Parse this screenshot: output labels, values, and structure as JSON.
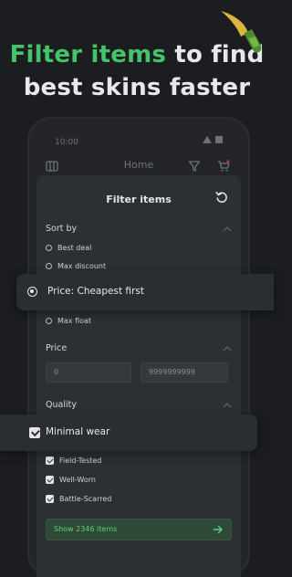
{
  "headline": {
    "line1_green": "Filter items",
    "line1_rest": " to find",
    "line2": "best skins faster"
  },
  "phone": {
    "status_time": "10:00",
    "appbar_title": "Home"
  },
  "filter": {
    "title": "Filter items",
    "sort": {
      "label": "Sort by",
      "options": [
        {
          "label": "Best deal",
          "selected": false
        },
        {
          "label": "Max discount",
          "selected": false
        },
        {
          "label": "Price: Cheapest first",
          "selected": true
        },
        {
          "label": "Max float",
          "selected": false
        }
      ]
    },
    "price": {
      "label": "Price",
      "min_value": "0",
      "max_value": "9999999999"
    },
    "quality": {
      "label": "Quality",
      "options": [
        {
          "label": "Minimal wear",
          "checked": true
        },
        {
          "label": "Field-Tested",
          "checked": true
        },
        {
          "label": "Well-Worn",
          "checked": true
        },
        {
          "label": "Battle-Scarred",
          "checked": true
        }
      ]
    },
    "show_button": "Show 2346 items"
  },
  "colors": {
    "accent": "#43c46a",
    "background": "#1b1d20",
    "sheet": "#2c2f33"
  }
}
